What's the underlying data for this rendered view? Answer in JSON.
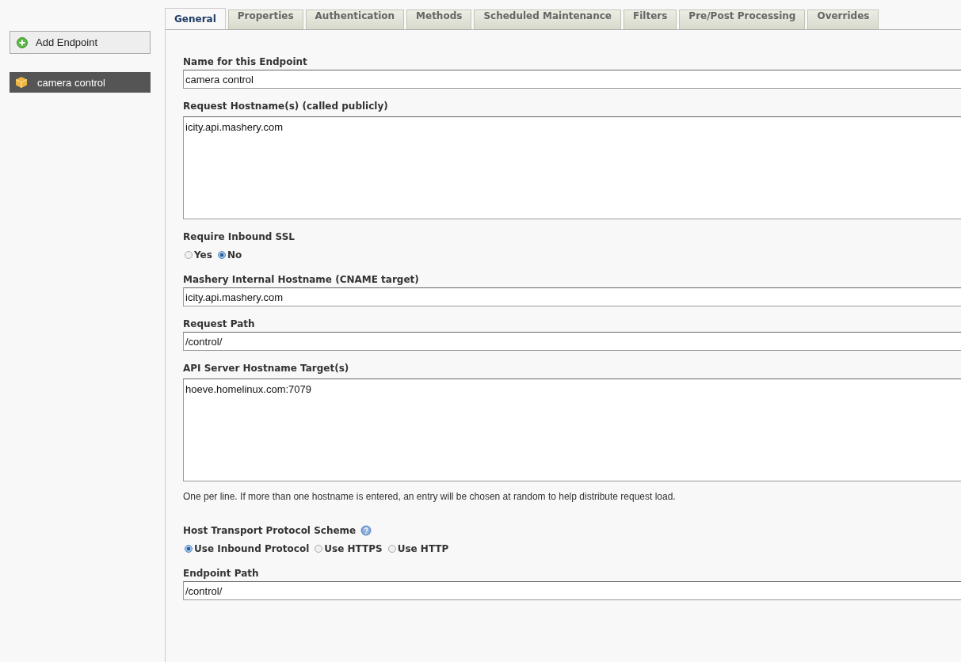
{
  "sidebar": {
    "add_button": "Add Endpoint",
    "endpoints": [
      {
        "label": "camera control",
        "selected": true
      }
    ]
  },
  "tabs": [
    {
      "label": "General",
      "selected": true
    },
    {
      "label": "Properties",
      "selected": false
    },
    {
      "label": "Authentication",
      "selected": false
    },
    {
      "label": "Methods",
      "selected": false
    },
    {
      "label": "Scheduled Maintenance",
      "selected": false
    },
    {
      "label": "Filters",
      "selected": false
    },
    {
      "label": "Pre/Post Processing",
      "selected": false
    },
    {
      "label": "Overrides",
      "selected": false
    }
  ],
  "fields": [
    {
      "kind": "text",
      "label": "Name for this Endpoint",
      "value": "camera control"
    },
    {
      "kind": "textarea",
      "label": "Request Hostname(s) (called publicly)",
      "value": "icity.api.mashery.com"
    },
    {
      "kind": "radio",
      "label": "Require Inbound SSL",
      "options": [
        {
          "label": "Yes",
          "selected": false
        },
        {
          "label": "No",
          "selected": true
        }
      ]
    },
    {
      "kind": "text",
      "label": "Mashery Internal Hostname (CNAME target)",
      "value": "icity.api.mashery.com"
    },
    {
      "kind": "text",
      "label": "Request Path",
      "value": "/control/"
    },
    {
      "kind": "textarea",
      "label": "API Server Hostname Target(s)",
      "value": "hoeve.homelinux.com:7079",
      "hint": "One per line. If more than one hostname is entered, an entry will be chosen at random to help distribute request load."
    },
    {
      "kind": "radio",
      "label": "Host Transport Protocol Scheme",
      "help": true,
      "options": [
        {
          "label": "Use Inbound Protocol",
          "selected": true
        },
        {
          "label": "Use HTTPS",
          "selected": false
        },
        {
          "label": "Use HTTP",
          "selected": false
        }
      ]
    },
    {
      "kind": "text",
      "label": "Endpoint Path",
      "value": "/control/"
    }
  ]
}
